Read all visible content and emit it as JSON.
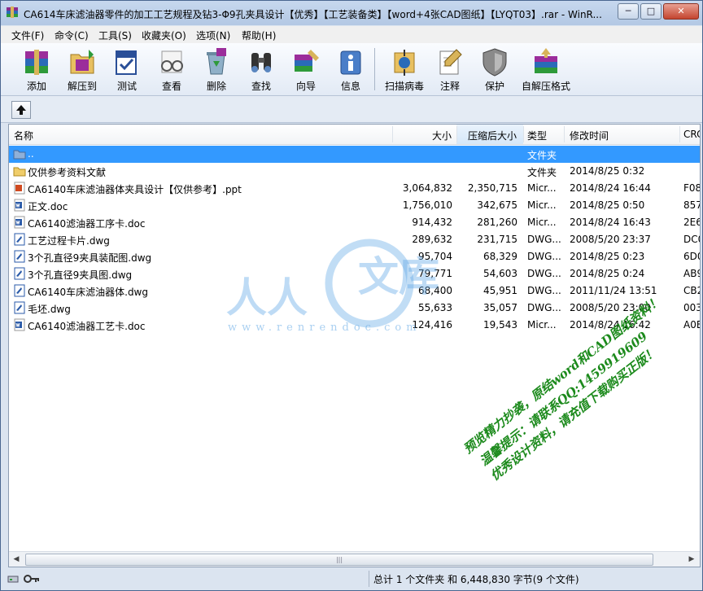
{
  "window": {
    "title": "CA614车床滤油器零件的加工工艺规程及钻3-Φ9孔夹具设计【优秀】【工艺装备类】【word+4张CAD图纸】【LYQT03】.rar - WinR...",
    "minimize": "─",
    "maximize": "□",
    "close": "✕"
  },
  "menu": [
    "文件(F)",
    "命令(C)",
    "工具(S)",
    "收藏夹(O)",
    "选项(N)",
    "帮助(H)"
  ],
  "toolbar": {
    "add": "添加",
    "extract": "解压到",
    "test": "测试",
    "view": "查看",
    "delete": "删除",
    "find": "查找",
    "wizard": "向导",
    "info": "信息",
    "scan": "扫描病毒",
    "comment": "注释",
    "protect": "保护",
    "sfx": "自解压格式"
  },
  "columns": {
    "name": "名称",
    "size": "大小",
    "packed": "压缩后大小",
    "type": "类型",
    "modified": "修改时间",
    "crc": "CRC"
  },
  "files": [
    {
      "name": "..",
      "size": "",
      "packed": "",
      "type": "文件夹",
      "modified": "",
      "crc": "",
      "icon": "parent-folder-icon"
    },
    {
      "name": "仅供参考资料文献",
      "size": "",
      "packed": "",
      "type": "文件夹",
      "modified": "2014/8/25 0:32",
      "crc": "",
      "icon": "folder-icon"
    },
    {
      "name": "CA6140车床滤油器体夹具设计【仅供参考】.ppt",
      "size": "3,064,832",
      "packed": "2,350,715",
      "type": "Micr...",
      "modified": "2014/8/24 16:44",
      "crc": "F08",
      "icon": "ppt-icon"
    },
    {
      "name": "正文.doc",
      "size": "1,756,010",
      "packed": "342,675",
      "type": "Micr...",
      "modified": "2014/8/25 0:50",
      "crc": "857",
      "icon": "doc-icon"
    },
    {
      "name": "CA6140滤油器工序卡.doc",
      "size": "914,432",
      "packed": "281,260",
      "type": "Micr...",
      "modified": "2014/8/24 16:43",
      "crc": "2E6",
      "icon": "doc-icon"
    },
    {
      "name": "工艺过程卡片.dwg",
      "size": "289,632",
      "packed": "231,715",
      "type": "DWG...",
      "modified": "2008/5/20 23:37",
      "crc": "DC0",
      "icon": "dwg-icon"
    },
    {
      "name": "3个孔直径9夹具装配图.dwg",
      "size": "95,704",
      "packed": "68,329",
      "type": "DWG...",
      "modified": "2014/8/25 0:23",
      "crc": "6D0",
      "icon": "dwg-icon"
    },
    {
      "name": "3个孔直径9夹具图.dwg",
      "size": "79,771",
      "packed": "54,603",
      "type": "DWG...",
      "modified": "2014/8/25 0:24",
      "crc": "AB9",
      "icon": "dwg-icon"
    },
    {
      "name": "CA6140车床滤油器体.dwg",
      "size": "68,400",
      "packed": "45,951",
      "type": "DWG...",
      "modified": "2011/11/24 13:51",
      "crc": "CB2",
      "icon": "dwg-icon"
    },
    {
      "name": "毛坯.dwg",
      "size": "55,633",
      "packed": "35,057",
      "type": "DWG...",
      "modified": "2008/5/20 23:00",
      "crc": "003",
      "icon": "dwg-icon"
    },
    {
      "name": "CA6140滤油器工艺卡.doc",
      "size": "124,416",
      "packed": "19,543",
      "type": "Micr...",
      "modified": "2014/8/24 16:42",
      "crc": "A0E",
      "icon": "doc-icon"
    }
  ],
  "status": {
    "summary": "总计 1 个文件夹 和 6,448,830 字节(9 个文件)"
  },
  "watermark": {
    "logo_left": "人人",
    "logo_right": "文库",
    "url": "www.renrendoc.com",
    "line1": "预览精力抄袭，原结word和CAD图纸资料！",
    "line2": "温馨提示：请联系QQ:1459919609",
    "line3": "优秀设计资料，请充值下载购买正版！"
  },
  "colors": {
    "selection": "#3399ff",
    "watermark_text": "#1c8a1c",
    "watermark_logo": "#64aae6"
  }
}
